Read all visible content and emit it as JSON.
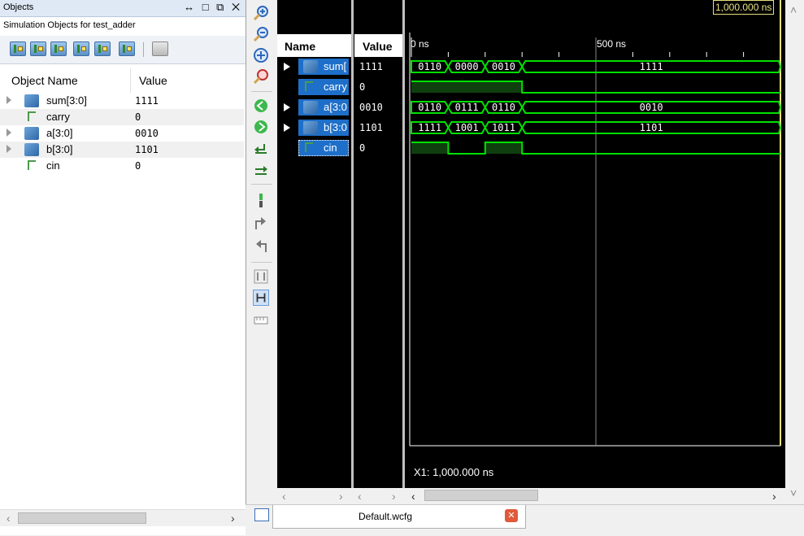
{
  "objects_panel": {
    "title": "Objects",
    "window_controls": "↔ □ ⧉ ✕",
    "subtitle": "Simulation Objects for test_adder",
    "col_name": "Object Name",
    "col_value": "Value",
    "rows": [
      {
        "name": "sum[3:0]",
        "value": "1111",
        "kind": "bus",
        "expandable": true
      },
      {
        "name": "carry",
        "value": "0",
        "kind": "bit",
        "expandable": false
      },
      {
        "name": "a[3:0]",
        "value": "0010",
        "kind": "bus",
        "expandable": true
      },
      {
        "name": "b[3:0]",
        "value": "1101",
        "kind": "bus",
        "expandable": true
      },
      {
        "name": "cin",
        "value": "0",
        "kind": "bit",
        "expandable": false
      }
    ]
  },
  "wave": {
    "name_header": "Name",
    "value_header": "Value",
    "signals": [
      {
        "name": "sum[",
        "value": "1111",
        "bus": true
      },
      {
        "name": "carry",
        "value": "0",
        "bus": false
      },
      {
        "name": "a[3:0",
        "value": "0010",
        "bus": true
      },
      {
        "name": "b[3:0",
        "value": "1101",
        "bus": true
      },
      {
        "name": "cin",
        "value": "0",
        "bus": false
      }
    ],
    "time_labels": [
      "0 ns",
      "500 ns"
    ],
    "cursor_time": "1,000.000 ns",
    "cursor_readout": "X1: 1,000.000 ns",
    "time_range_ns": [
      0,
      1000
    ],
    "waveforms": [
      {
        "signal": "sum",
        "segments": [
          {
            "from": 0,
            "to": 100,
            "label": "0110"
          },
          {
            "from": 100,
            "to": 200,
            "label": "0000"
          },
          {
            "from": 200,
            "to": 300,
            "label": "0010"
          },
          {
            "from": 300,
            "to": 1000,
            "label": "1111"
          }
        ]
      },
      {
        "signal": "carry",
        "levels": [
          {
            "from": 0,
            "to": 300,
            "level": 1
          },
          {
            "from": 300,
            "to": 1000,
            "level": 0
          }
        ]
      },
      {
        "signal": "a",
        "segments": [
          {
            "from": 0,
            "to": 100,
            "label": "0110"
          },
          {
            "from": 100,
            "to": 200,
            "label": "0111"
          },
          {
            "from": 200,
            "to": 300,
            "label": "0110"
          },
          {
            "from": 300,
            "to": 1000,
            "label": "0010"
          }
        ]
      },
      {
        "signal": "b",
        "segments": [
          {
            "from": 0,
            "to": 100,
            "label": "1111"
          },
          {
            "from": 100,
            "to": 200,
            "label": "1001"
          },
          {
            "from": 200,
            "to": 300,
            "label": "1011"
          },
          {
            "from": 300,
            "to": 1000,
            "label": "1101"
          }
        ]
      },
      {
        "signal": "cin",
        "levels": [
          {
            "from": 0,
            "to": 100,
            "level": 1
          },
          {
            "from": 100,
            "to": 200,
            "level": 0
          },
          {
            "from": 200,
            "to": 300,
            "level": 1
          },
          {
            "from": 300,
            "to": 1000,
            "level": 0
          }
        ]
      }
    ],
    "wave_color": "#00e000",
    "cursor_color": "#e8e080"
  },
  "tabs": {
    "active": "Default.wcfg"
  }
}
